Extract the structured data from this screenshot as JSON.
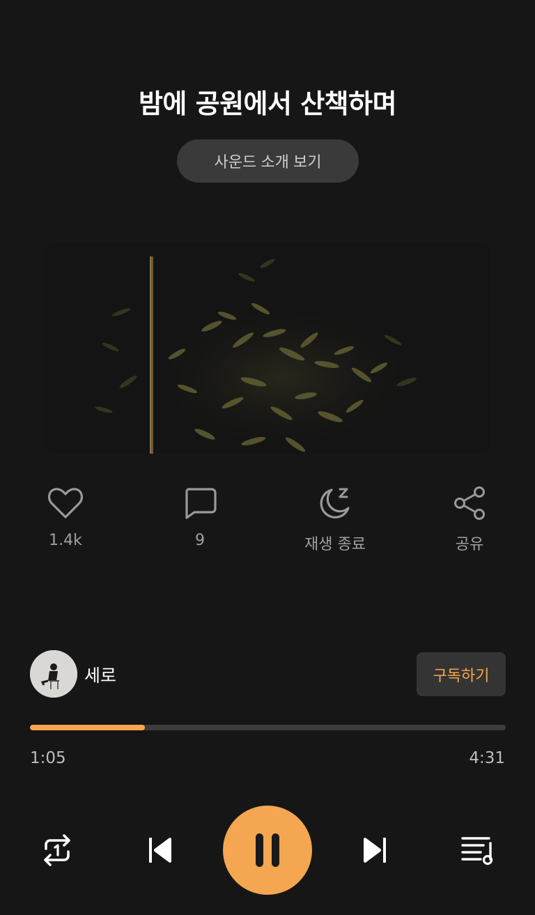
{
  "track": {
    "title": "밤에 공원에서 산책하며",
    "intro_button_label": "사운드 소개 보기"
  },
  "cover": {
    "description_icon": "night-bamboo-image"
  },
  "actions": {
    "like": {
      "icon": "heart-icon",
      "label": "1.4k"
    },
    "comment": {
      "icon": "comment-icon",
      "label": "9"
    },
    "sleep_timer": {
      "icon": "moon-sleep-icon",
      "label": "재생 종료"
    },
    "share": {
      "icon": "share-icon",
      "label": "공유"
    }
  },
  "creator": {
    "name": "세로",
    "subscribe_label": "구독하기"
  },
  "player": {
    "current_time": "1:05",
    "total_time": "4:31",
    "progress": 0.242,
    "controls": {
      "repeat_icon": "repeat-one-icon",
      "previous_icon": "skip-previous-icon",
      "play_pause_icon": "pause-icon",
      "next_icon": "skip-next-icon",
      "playlist_icon": "playlist-icon"
    }
  },
  "colors": {
    "background": "#161616",
    "accent": "#f5a650",
    "subscribe_text": "#f5a64a"
  }
}
